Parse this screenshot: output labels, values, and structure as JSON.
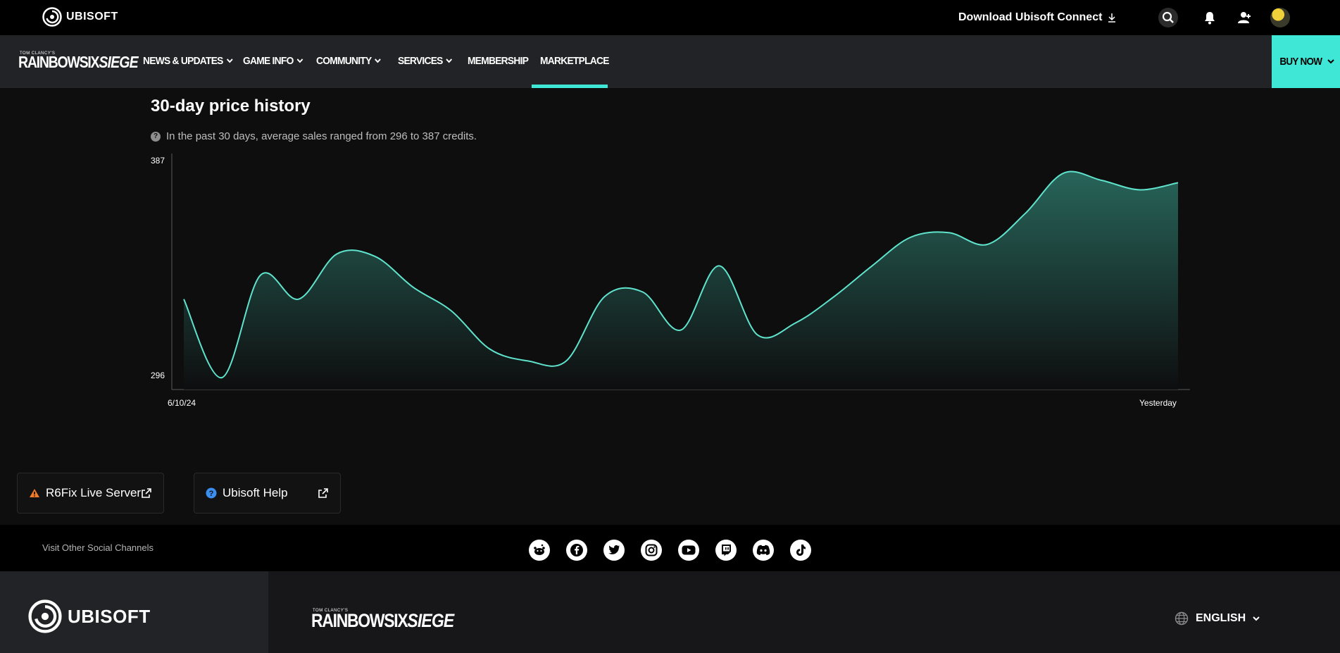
{
  "topbar": {
    "brand": "UBISOFT",
    "download_label": "Download Ubisoft Connect",
    "icons": [
      "download-icon",
      "search-icon",
      "bell-icon",
      "friends-icon",
      "avatar"
    ]
  },
  "nav": {
    "logo_small": "TOM CLANCY'S",
    "logo_main": "RAINBOWSIX",
    "logo_accent": "SIEGE",
    "items": [
      {
        "label": "NEWS & UPDATES",
        "has_dropdown": true
      },
      {
        "label": "GAME INFO",
        "has_dropdown": true
      },
      {
        "label": "COMMUNITY",
        "has_dropdown": true
      },
      {
        "label": "SERVICES",
        "has_dropdown": true
      },
      {
        "label": "MEMBERSHIP",
        "has_dropdown": false
      },
      {
        "label": "MARKETPLACE",
        "has_dropdown": false,
        "active": true
      }
    ],
    "buy_now": "BUY NOW",
    "accent_color": "#3fe8d6"
  },
  "price_history": {
    "title": "30-day price history",
    "info": "In the past 30 days, average sales ranged from 296 to 387 credits.",
    "y_max_label": "387",
    "y_min_label": "296",
    "x_start_label": "6/10/24",
    "x_end_label": "Yesterday"
  },
  "chart_data": {
    "type": "area",
    "ylim": [
      296,
      387
    ],
    "y_ticks": [
      "387",
      "296"
    ],
    "x_ticks": [
      "6/10/24",
      "Yesterday"
    ],
    "values": [
      329,
      296,
      339,
      329,
      348,
      347,
      334,
      324,
      308,
      303,
      303,
      330,
      332,
      316,
      343,
      314,
      319,
      330,
      343,
      355,
      357,
      352,
      365,
      382,
      379,
      375,
      378
    ],
    "color": "#5fe3cc",
    "grid": false
  },
  "help_cards": [
    {
      "label": "R6Fix Live Server",
      "icon": "warning-icon",
      "icon_color": "#f07a2a"
    },
    {
      "label": "Ubisoft Help",
      "icon": "help-icon",
      "icon_color": "#3b8ff0"
    }
  ],
  "social": {
    "label": "Visit Other Social Channels",
    "icons": [
      "reddit-icon",
      "facebook-icon",
      "twitter-icon",
      "instagram-icon",
      "youtube-icon",
      "twitch-icon",
      "discord-icon",
      "tiktok-icon"
    ]
  },
  "footer": {
    "brand": "UBISOFT",
    "logo_small": "TOM CLANCY'S",
    "logo_main": "RAINBOWSIX",
    "logo_accent": "SIEGE",
    "language": "ENGLISH"
  }
}
